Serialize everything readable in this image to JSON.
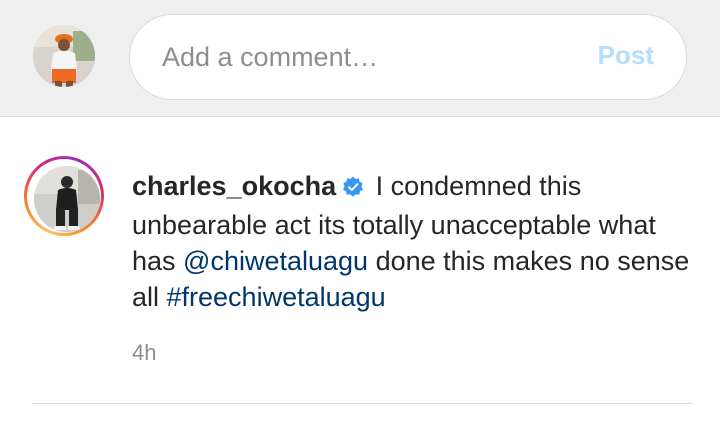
{
  "composer": {
    "avatar_icon": "profile-photo",
    "input_value": "",
    "placeholder": "Add a comment…",
    "post_label": "Post",
    "post_color": "#b2dffc"
  },
  "comment": {
    "username": "charles_okocha",
    "verified": true,
    "verified_icon": "verified-badge-icon",
    "text_before_mention": "I condemned this unbearable act its totally unacceptable what has ",
    "mention": "@chiwetaluagu",
    "text_after_mention": " done this makes no sense all ",
    "hashtag": "#freechiwetaluagu",
    "timestamp": "4h",
    "has_story_ring": true,
    "link_color": "#00376b"
  }
}
